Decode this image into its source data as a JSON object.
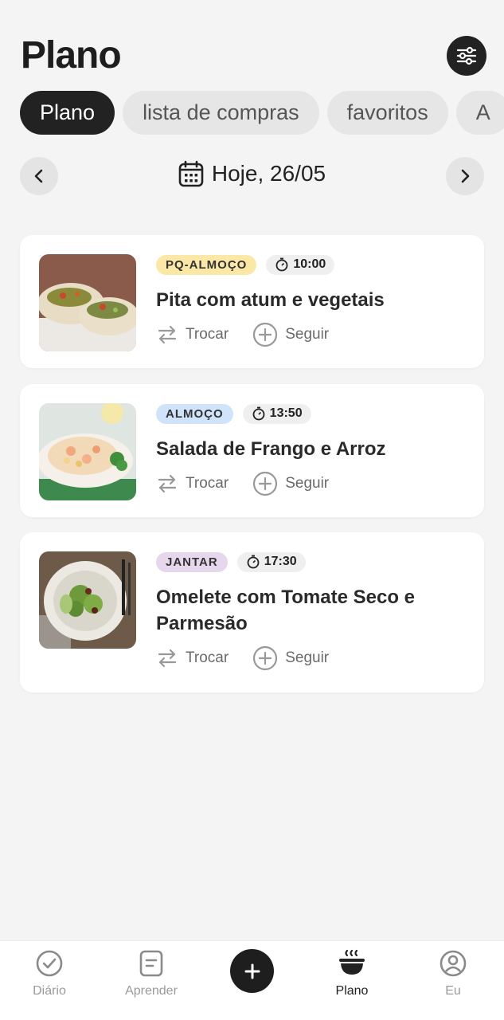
{
  "header": {
    "title": "Plano"
  },
  "tabs": [
    {
      "label": "Plano"
    },
    {
      "label": "lista de compras"
    },
    {
      "label": "favoritos"
    },
    {
      "label": "A"
    }
  ],
  "date": {
    "label": "Hoje, 26/05"
  },
  "meals": [
    {
      "type": "PQ-ALMOÇO",
      "badge_color": "#fbe8a6",
      "time": "10:00",
      "name": "Pita com atum e vegetais",
      "swap_label": "Trocar",
      "follow_label": "Seguir"
    },
    {
      "type": "ALMOÇO",
      "badge_color": "#cfe3fb",
      "time": "13:50",
      "name": "Salada de Frango e Arroz",
      "swap_label": "Trocar",
      "follow_label": "Seguir"
    },
    {
      "type": "JANTAR",
      "badge_color": "#e7d7ec",
      "time": "17:30",
      "name": "Omelete com Tomate Seco e Parmesão",
      "swap_label": "Trocar",
      "follow_label": "Seguir"
    }
  ],
  "bottom_nav": [
    {
      "label": "Diário",
      "icon": "check-circle-icon"
    },
    {
      "label": "Aprender",
      "icon": "document-icon"
    },
    {
      "label": "",
      "icon": "plus-icon"
    },
    {
      "label": "Plano",
      "icon": "bowl-icon"
    },
    {
      "label": "Eu",
      "icon": "profile-icon"
    }
  ],
  "colors": {
    "accent": "#222222",
    "background": "#f4f4f4"
  }
}
